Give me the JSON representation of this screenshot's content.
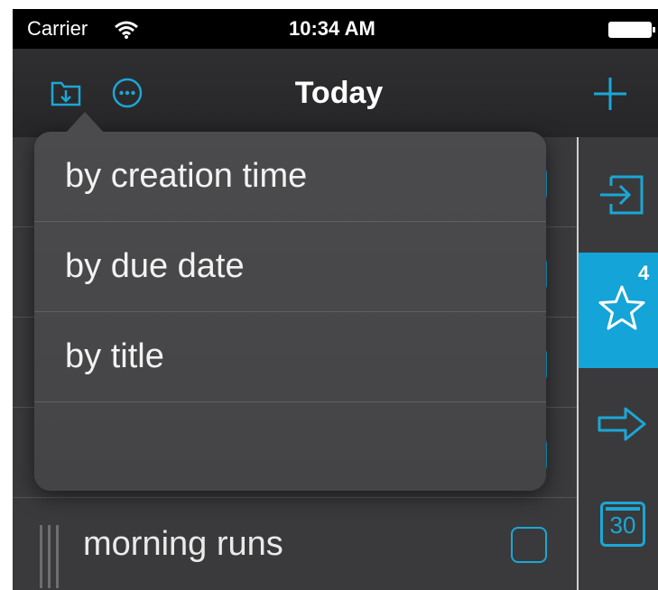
{
  "status_bar": {
    "carrier": "Carrier",
    "time": "10:34 AM",
    "wifi_icon": "wifi-icon",
    "battery_icon": "battery-full-icon"
  },
  "nav_bar": {
    "title": "Today",
    "left_icons": [
      "folder-download-icon",
      "more-options-icon"
    ],
    "right_icon": "plus-icon"
  },
  "sort_menu": {
    "items": [
      {
        "label": "by creation time"
      },
      {
        "label": "by due date"
      },
      {
        "label": "by title"
      },
      {
        "label": ""
      }
    ]
  },
  "task_list": {
    "rows": [
      {
        "title": ""
      },
      {
        "title": ""
      },
      {
        "title": ""
      },
      {
        "title": ""
      },
      {
        "title": "morning runs"
      }
    ]
  },
  "sidebar": {
    "items": [
      {
        "icon": "inbox-icon",
        "badge": ""
      },
      {
        "icon": "star-icon",
        "badge": "4",
        "active": true
      },
      {
        "icon": "arrow-right-icon",
        "badge": ""
      },
      {
        "icon": "calendar-icon",
        "label": "30"
      }
    ]
  },
  "colors": {
    "accent": "#1ba7d6",
    "active_bg": "#14a4d8",
    "background": "#3a3a3c",
    "popover": "#4b4b4d"
  }
}
